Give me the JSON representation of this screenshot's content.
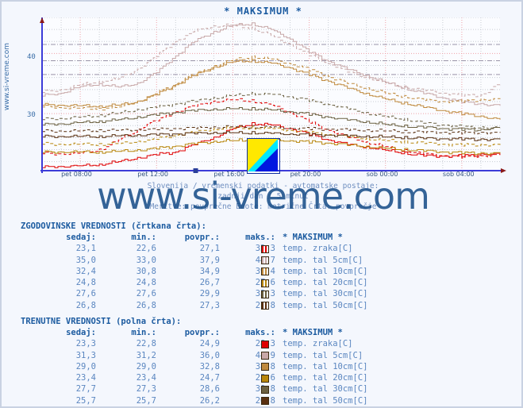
{
  "chart": {
    "title": "* MAKSIMUM *",
    "left_watermark": "www.si-vreme.com",
    "big_watermark": "www.si-vreme.com",
    "subtitle_line1": "Slovenija / vremenski podatki - avtomatske postaje:",
    "subtitle_line2": "zadnji dan / 5 minut",
    "subtitle_line3": "Meritve: povprečne  Enote: metrične  Črta: povprečje",
    "logo_colors": [
      "#ffe800",
      "#00e8ff",
      "#0018e0"
    ]
  },
  "chart_data": {
    "type": "line",
    "title": "* MAKSIMUM *",
    "xlabel": "",
    "ylabel": "",
    "grid": true,
    "legend_position": "below-table",
    "xlim": [
      6,
      30
    ],
    "ylim": [
      20.5,
      46
    ],
    "yticks": [
      30,
      40
    ],
    "ytick_labels": [
      "30",
      "40"
    ],
    "xticks": [
      8,
      12,
      16,
      20,
      24,
      28
    ],
    "xtick_labels": [
      "pet 08:00",
      "pet 12:00",
      "pet 16:00",
      "pet 20:00",
      "sob 00:00",
      "sob 04:00"
    ],
    "series": [
      {
        "name": "temp. zraka[C] (trenutne)",
        "color": "#e00000",
        "style": "solid",
        "x": [
          6,
          7,
          8,
          9,
          10,
          11,
          12,
          13,
          14,
          15,
          16,
          17,
          18,
          19,
          20,
          21,
          22,
          23,
          24,
          25,
          26,
          27,
          28,
          29,
          30
        ],
        "y": [
          21.1,
          21.2,
          21.3,
          21.5,
          22.0,
          22.6,
          23.2,
          23.6,
          24.9,
          26.0,
          27.5,
          28.3,
          28.1,
          27.5,
          26.6,
          25.6,
          24.9,
          24.4,
          23.9,
          23.4,
          23.0,
          22.9,
          23.0,
          23.2,
          23.3
        ]
      },
      {
        "name": "temp. zraka[C] (zgodovinske)",
        "color": "#e00000",
        "style": "dashed",
        "x": [
          6,
          7,
          8,
          9,
          10,
          11,
          12,
          13,
          14,
          15,
          16,
          17,
          18,
          19,
          20,
          21,
          22,
          23,
          24,
          25,
          26,
          27,
          28,
          29,
          30
        ],
        "y": [
          23.4,
          23.3,
          23.4,
          24.0,
          25.6,
          27.3,
          28.9,
          30.3,
          31.3,
          32.0,
          32.3,
          32.1,
          31.4,
          30.2,
          28.6,
          27.2,
          26.1,
          25.2,
          24.5,
          23.8,
          23.3,
          23.0,
          22.8,
          22.9,
          23.1
        ]
      },
      {
        "name": "temp. tal 5cm[C] (trenutne)",
        "color": "#c8a8a8",
        "style": "solid",
        "x": [
          6,
          7,
          8,
          9,
          10,
          11,
          12,
          13,
          14,
          15,
          16,
          17,
          18,
          19,
          20,
          21,
          22,
          23,
          24,
          25,
          26,
          27,
          28,
          29,
          30
        ],
        "y": [
          33.0,
          33.4,
          34.5,
          34.9,
          34.4,
          35.0,
          36.9,
          39.6,
          42.1,
          43.6,
          44.7,
          44.9,
          44.0,
          42.4,
          40.3,
          38.7,
          37.4,
          36.3,
          35.2,
          34.2,
          33.4,
          32.6,
          32.0,
          31.6,
          31.3
        ]
      },
      {
        "name": "temp. tal 5cm[C] (zgodovinske)",
        "color": "#c8a8a8",
        "style": "dashed",
        "x": [
          6,
          7,
          8,
          9,
          10,
          11,
          12,
          13,
          14,
          15,
          16,
          17,
          18,
          19,
          20,
          21,
          22,
          23,
          24,
          25,
          26,
          27,
          28,
          29,
          30
        ],
        "y": [
          33.6,
          34.0,
          34.8,
          35.3,
          35.8,
          37.3,
          39.6,
          42.0,
          43.8,
          44.5,
          44.7,
          44.2,
          43.0,
          41.5,
          39.8,
          38.3,
          37.0,
          36.0,
          35.1,
          34.4,
          33.9,
          33.4,
          33.1,
          33.0,
          35.0
        ]
      },
      {
        "name": "temp. tal 10cm[C] (trenutne)",
        "color": "#c08a3e",
        "style": "solid",
        "x": [
          6,
          7,
          8,
          9,
          10,
          11,
          12,
          13,
          14,
          15,
          16,
          17,
          18,
          19,
          20,
          21,
          22,
          23,
          24,
          25,
          26,
          27,
          28,
          29,
          30
        ],
        "y": [
          31.5,
          31.4,
          31.3,
          31.2,
          31.4,
          32.0,
          33.2,
          34.8,
          36.4,
          37.7,
          38.6,
          38.8,
          38.4,
          37.6,
          36.5,
          35.4,
          34.3,
          33.3,
          32.4,
          31.7,
          31.1,
          30.5,
          30.0,
          29.5,
          29.0
        ]
      },
      {
        "name": "temp. tal 10cm[C] (zgodovinske)",
        "color": "#c08a3e",
        "style": "dashed",
        "x": [
          6,
          7,
          8,
          9,
          10,
          11,
          12,
          13,
          14,
          15,
          16,
          17,
          18,
          19,
          20,
          21,
          22,
          23,
          24,
          25,
          26,
          27,
          28,
          29,
          30
        ],
        "y": [
          31.2,
          31.0,
          30.9,
          30.8,
          31.1,
          32.0,
          33.4,
          35.0,
          36.6,
          37.9,
          38.9,
          39.4,
          39.1,
          38.3,
          37.3,
          36.2,
          35.1,
          34.2,
          33.4,
          32.8,
          32.3,
          32.0,
          32.1,
          32.3,
          32.4
        ]
      },
      {
        "name": "temp. tal 20cm[C] (trenutne)",
        "color": "#b8860b",
        "style": "solid",
        "x": [
          6,
          7,
          8,
          9,
          10,
          11,
          12,
          13,
          14,
          15,
          16,
          17,
          18,
          19,
          20,
          21,
          22,
          23,
          24,
          25,
          26,
          27,
          28,
          29,
          30
        ],
        "y": [
          23.6,
          23.6,
          23.6,
          23.6,
          23.7,
          23.9,
          24.2,
          24.6,
          25.0,
          25.3,
          25.5,
          25.6,
          25.6,
          25.5,
          25.3,
          25.1,
          24.8,
          24.5,
          24.2,
          24.0,
          23.8,
          23.6,
          23.5,
          23.4,
          23.4
        ]
      },
      {
        "name": "temp. tal 20cm[C] (zgodovinske)",
        "color": "#b8860b",
        "style": "dashed",
        "x": [
          6,
          7,
          8,
          9,
          10,
          11,
          12,
          13,
          14,
          15,
          16,
          17,
          18,
          19,
          20,
          21,
          22,
          23,
          24,
          25,
          26,
          27,
          28,
          29,
          30
        ],
        "y": [
          25.0,
          24.9,
          24.9,
          24.9,
          25.0,
          25.3,
          25.8,
          26.4,
          27.0,
          27.4,
          27.6,
          27.6,
          27.5,
          27.2,
          26.9,
          26.5,
          26.2,
          25.8,
          25.5,
          25.3,
          25.1,
          24.9,
          24.8,
          24.8,
          24.8
        ]
      },
      {
        "name": "temp. tal 30cm[C] (trenutne)",
        "color": "#6b6040",
        "style": "solid",
        "x": [
          6,
          7,
          8,
          9,
          10,
          11,
          12,
          13,
          14,
          15,
          16,
          17,
          18,
          19,
          20,
          21,
          22,
          23,
          24,
          25,
          26,
          27,
          28,
          29,
          30
        ],
        "y": [
          28.2,
          28.3,
          28.5,
          28.7,
          29.0,
          29.4,
          29.8,
          30.2,
          30.5,
          30.7,
          30.8,
          30.8,
          30.6,
          30.3,
          29.9,
          29.4,
          29.0,
          28.6,
          28.2,
          27.9,
          27.7,
          27.5,
          27.4,
          27.3,
          27.7
        ]
      },
      {
        "name": "temp. tal 30cm[C] (zgodovinske)",
        "color": "#6b6040",
        "style": "dashed",
        "x": [
          6,
          7,
          8,
          9,
          10,
          11,
          12,
          13,
          14,
          15,
          16,
          17,
          18,
          19,
          20,
          21,
          22,
          23,
          24,
          25,
          26,
          27,
          28,
          29,
          30
        ],
        "y": [
          29.1,
          29.2,
          29.4,
          29.7,
          30.1,
          30.6,
          31.1,
          31.6,
          32.1,
          32.6,
          33.0,
          33.3,
          33.2,
          32.8,
          32.2,
          31.5,
          30.8,
          30.1,
          29.5,
          29.0,
          28.5,
          28.1,
          27.8,
          27.7,
          27.6
        ]
      },
      {
        "name": "temp. tal 50cm[C] (trenutne)",
        "color": "#5a3010",
        "style": "solid",
        "x": [
          6,
          7,
          8,
          9,
          10,
          11,
          12,
          13,
          14,
          15,
          16,
          17,
          18,
          19,
          20,
          21,
          22,
          23,
          24,
          25,
          26,
          27,
          28,
          29,
          30
        ],
        "y": [
          26.2,
          26.2,
          26.2,
          26.2,
          26.3,
          26.4,
          26.5,
          26.6,
          26.7,
          26.8,
          26.8,
          26.8,
          26.7,
          26.6,
          26.5,
          26.4,
          26.3,
          26.2,
          26.1,
          26.0,
          25.9,
          25.8,
          25.8,
          25.7,
          25.7
        ]
      },
      {
        "name": "temp. tal 50cm[C] (zgodovinske)",
        "color": "#5a3010",
        "style": "dashed",
        "x": [
          6,
          7,
          8,
          9,
          10,
          11,
          12,
          13,
          14,
          15,
          16,
          17,
          18,
          19,
          20,
          21,
          22,
          23,
          24,
          25,
          26,
          27,
          28,
          29,
          30
        ],
        "y": [
          27.1,
          27.1,
          27.1,
          27.2,
          27.2,
          27.3,
          27.4,
          27.5,
          27.6,
          27.7,
          27.8,
          27.8,
          27.7,
          27.6,
          27.5,
          27.4,
          27.3,
          27.2,
          27.1,
          27.0,
          26.9,
          26.9,
          26.8,
          26.8,
          26.8
        ]
      }
    ]
  },
  "historical": {
    "title": "ZGODOVINSKE VREDNOSTI (črtkana črta):",
    "headers": {
      "sedaj": "sedaj:",
      "min": "min.:",
      "povpr": "povpr.:",
      "maks": "maks.:",
      "station": "* MAKSIMUM *"
    },
    "rows": [
      {
        "sedaj": "23,1",
        "min": "22,6",
        "povpr": "27,1",
        "maks": "32,3",
        "color": "#e00000",
        "label": "temp. zraka[C]"
      },
      {
        "sedaj": "35,0",
        "min": "33,0",
        "povpr": "37,9",
        "maks": "44,7",
        "color": "#c8a8a8",
        "label": "temp. tal  5cm[C]"
      },
      {
        "sedaj": "32,4",
        "min": "30,8",
        "povpr": "34,9",
        "maks": "39,4",
        "color": "#c08a3e",
        "label": "temp. tal 10cm[C]"
      },
      {
        "sedaj": "24,8",
        "min": "24,8",
        "povpr": "26,7",
        "maks": "27,6",
        "color": "#b8860b",
        "label": "temp. tal 20cm[C]"
      },
      {
        "sedaj": "27,6",
        "min": "27,6",
        "povpr": "29,9",
        "maks": "33,3",
        "color": "#6b6040",
        "label": "temp. tal 30cm[C]"
      },
      {
        "sedaj": "26,8",
        "min": "26,8",
        "povpr": "27,3",
        "maks": "27,8",
        "color": "#5a3010",
        "label": "temp. tal 50cm[C]"
      }
    ]
  },
  "current": {
    "title": "TRENUTNE VREDNOSTI (polna črta):",
    "headers": {
      "sedaj": "sedaj:",
      "min": "min.:",
      "povpr": "povpr.:",
      "maks": "maks.:",
      "station": "* MAKSIMUM *"
    },
    "rows": [
      {
        "sedaj": "23,3",
        "min": "22,8",
        "povpr": "24,9",
        "maks": "28,3",
        "color": "#e00000",
        "label": "temp. zraka[C]"
      },
      {
        "sedaj": "31,3",
        "min": "31,2",
        "povpr": "36,0",
        "maks": "44,9",
        "color": "#c8a8a8",
        "label": "temp. tal  5cm[C]"
      },
      {
        "sedaj": "29,0",
        "min": "29,0",
        "povpr": "32,8",
        "maks": "38,8",
        "color": "#c08a3e",
        "label": "temp. tal 10cm[C]"
      },
      {
        "sedaj": "23,4",
        "min": "23,4",
        "povpr": "24,7",
        "maks": "25,6",
        "color": "#b8860b",
        "label": "temp. tal 20cm[C]"
      },
      {
        "sedaj": "27,7",
        "min": "27,3",
        "povpr": "28,6",
        "maks": "30,8",
        "color": "#6b6040",
        "label": "temp. tal 30cm[C]"
      },
      {
        "sedaj": "25,7",
        "min": "25,7",
        "povpr": "26,2",
        "maks": "26,8",
        "color": "#5a3010",
        "label": "temp. tal 50cm[C]"
      }
    ]
  }
}
